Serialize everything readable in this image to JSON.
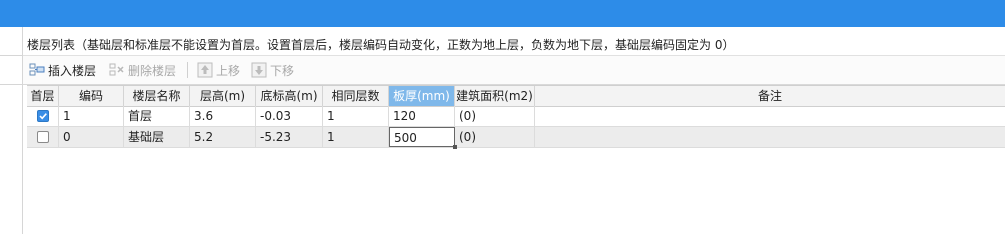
{
  "panel": {
    "caption": "楼层列表（基础层和标准层不能设置为首层。设置首层后，楼层编码自动变化，正数为地上层，负数为地下层，基础层编码固定为 0）"
  },
  "toolbar": {
    "insert_label": "插入楼层",
    "delete_label": "删除楼层",
    "up_label": "上移",
    "down_label": "下移"
  },
  "table": {
    "columns": [
      "首层",
      "编码",
      "楼层名称",
      "层高(m)",
      "底标高(m)",
      "相同层数",
      "板厚(mm)",
      "建筑面积(m2)",
      "备注"
    ],
    "selected_column": "板厚(mm)",
    "rows": [
      {
        "first_floor": true,
        "code": "1",
        "name": "首层",
        "height": "3.6",
        "bottom_elev": "-0.03",
        "same_count": "1",
        "slab": "120",
        "area": "(0)",
        "remark": ""
      },
      {
        "first_floor": false,
        "code": "0",
        "name": "基础层",
        "height": "5.2",
        "bottom_elev": "-5.23",
        "same_count": "1",
        "slab": "500",
        "area": "(0)",
        "remark": ""
      }
    ]
  },
  "colors": {
    "titlebar": "#2d8ce8",
    "selected_header": "#7fb8ea",
    "checkbox_checked": "#3a8ee6"
  },
  "icons": [
    "insert-floor-icon",
    "delete-floor-icon",
    "move-up-icon",
    "move-down-icon",
    "checkmark-icon"
  ]
}
